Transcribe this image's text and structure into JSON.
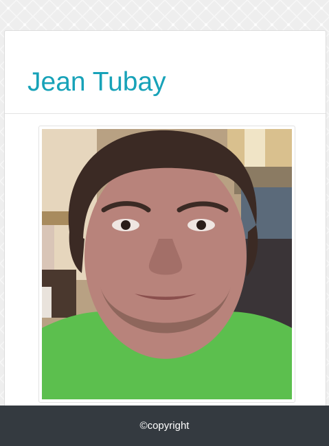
{
  "header": {
    "name": "Jean Tubay"
  },
  "profile_photo": {
    "description_icon": "profile-photo"
  },
  "footer": {
    "text": "©copyright"
  },
  "colors": {
    "title": "#17a2b8",
    "footer_bg": "#343a40",
    "footer_text": "#ffffff",
    "page_bg": "#eeeeee",
    "card_bg": "#ffffff",
    "shirt": "#5cbf4e"
  }
}
